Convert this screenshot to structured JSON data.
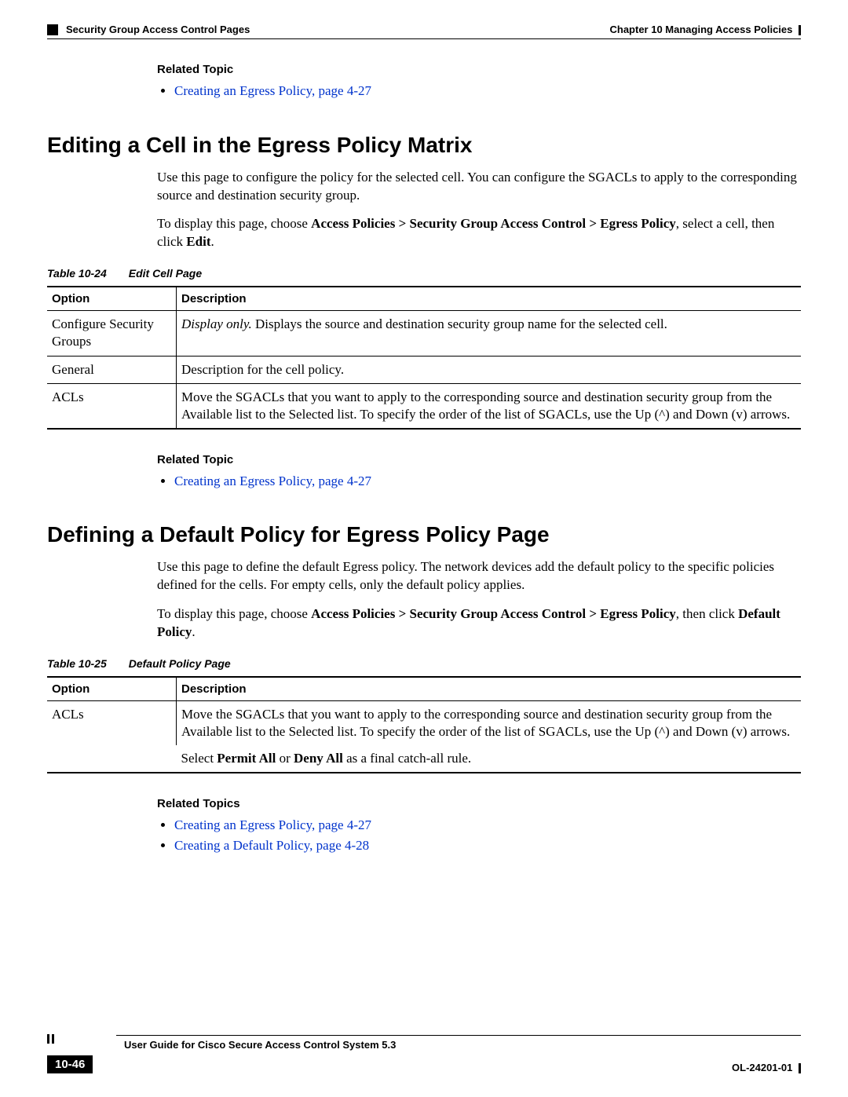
{
  "header": {
    "chapter": "Chapter 10    Managing Access Policies",
    "section": "Security Group Access Control Pages"
  },
  "relatedTopic1": {
    "heading": "Related Topic",
    "link": "Creating an Egress Policy, page 4-27"
  },
  "section1": {
    "title": "Editing a Cell in the Egress Policy Matrix",
    "p1": "Use this page to configure the policy for the selected cell. You can configure the SGACLs to apply to the corresponding source and destination security group.",
    "p2a": "To display this page, choose ",
    "p2b": "Access Policies > Security Group Access Control > Egress Policy",
    "p2c": ", select a cell, then click ",
    "p2d": "Edit",
    "p2e": "."
  },
  "table1": {
    "num": "Table 10-24",
    "title": "Edit Cell Page",
    "h1": "Option",
    "h2": "Description",
    "rows": [
      {
        "opt": "Configure Security Groups",
        "descA": "Display only.",
        "descB": " Displays the source and destination security group name for the selected cell."
      },
      {
        "opt": "General",
        "descA": "",
        "descB": "Description for the cell policy."
      },
      {
        "opt": "ACLs",
        "descA": "",
        "descB": "Move the SGACLs that you want to apply to the corresponding source and destination security group from the Available list to the Selected list. To specify the order of the list of SGACLs, use the Up (^) and Down (v) arrows."
      }
    ]
  },
  "relatedTopic2": {
    "heading": "Related Topic",
    "link": "Creating an Egress Policy, page 4-27"
  },
  "section2": {
    "title": "Defining a Default Policy for Egress Policy Page",
    "p1": "Use this page to define the default Egress policy. The network devices add the default policy to the specific policies defined for the cells. For empty cells, only the default policy applies.",
    "p2a": "To display this page, choose ",
    "p2b": "Access Policies > Security Group Access Control > Egress Policy",
    "p2c": ", then click ",
    "p2d": "Default Policy",
    "p2e": "."
  },
  "table2": {
    "num": "Table 10-25",
    "title": "Default Policy Page",
    "h1": "Option",
    "h2": "Description",
    "row1opt": "ACLs",
    "row1desc": "Move the SGACLs that you want to apply to the corresponding source and destination security group from the Available list to the Selected list. To specify the order of the list of SGACLs, use the Up (^) and Down (v) arrows.",
    "row2a": "Select ",
    "row2b": "Permit All",
    "row2c": " or ",
    "row2d": "Deny All",
    "row2e": " as a final catch-all rule."
  },
  "relatedTopics3": {
    "heading": "Related Topics",
    "link1": "Creating an Egress Policy, page 4-27",
    "link2": "Creating a Default Policy, page 4-28"
  },
  "footer": {
    "book": "User Guide for Cisco Secure Access Control System 5.3",
    "page": "10-46",
    "doc": "OL-24201-01"
  }
}
